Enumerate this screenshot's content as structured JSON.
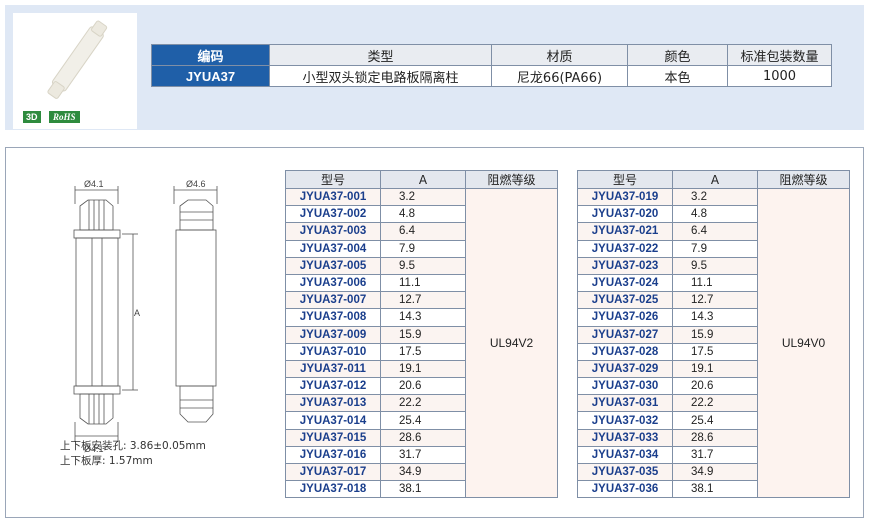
{
  "badges": {
    "three_d": "3D",
    "rohs": "RoHS"
  },
  "spec_table": {
    "headers": [
      "编码",
      "类型",
      "材质",
      "颜色",
      "标准包装数量"
    ],
    "row": [
      "JYUA37",
      "小型双头锁定电路板隔离柱",
      "尼龙66(PA66)",
      "本色",
      "1000"
    ]
  },
  "drawing": {
    "dim_top_left": "Ø4.1",
    "dim_top_right": "Ø4.6",
    "dim_bottom": "Ø4.1",
    "dim_length": "A"
  },
  "notes": {
    "hole": "上下板安装孔: 3.86±0.05mm",
    "thickness": "上下板厚: 1.57mm"
  },
  "parts_headers": [
    "型号",
    "A",
    "阻燃等级"
  ],
  "parts_left": {
    "grade": "UL94V2",
    "rows": [
      [
        "JYUA37-001",
        "3.2"
      ],
      [
        "JYUA37-002",
        "4.8"
      ],
      [
        "JYUA37-003",
        "6.4"
      ],
      [
        "JYUA37-004",
        "7.9"
      ],
      [
        "JYUA37-005",
        "9.5"
      ],
      [
        "JYUA37-006",
        "11.1"
      ],
      [
        "JYUA37-007",
        "12.7"
      ],
      [
        "JYUA37-008",
        "14.3"
      ],
      [
        "JYUA37-009",
        "15.9"
      ],
      [
        "JYUA37-010",
        "17.5"
      ],
      [
        "JYUA37-011",
        "19.1"
      ],
      [
        "JYUA37-012",
        "20.6"
      ],
      [
        "JYUA37-013",
        "22.2"
      ],
      [
        "JYUA37-014",
        "25.4"
      ],
      [
        "JYUA37-015",
        "28.6"
      ],
      [
        "JYUA37-016",
        "31.7"
      ],
      [
        "JYUA37-017",
        "34.9"
      ],
      [
        "JYUA37-018",
        "38.1"
      ]
    ]
  },
  "parts_right": {
    "grade": "UL94V0",
    "rows": [
      [
        "JYUA37-019",
        "3.2"
      ],
      [
        "JYUA37-020",
        "4.8"
      ],
      [
        "JYUA37-021",
        "6.4"
      ],
      [
        "JYUA37-022",
        "7.9"
      ],
      [
        "JYUA37-023",
        "9.5"
      ],
      [
        "JYUA37-024",
        "11.1"
      ],
      [
        "JYUA37-025",
        "12.7"
      ],
      [
        "JYUA37-026",
        "14.3"
      ],
      [
        "JYUA37-027",
        "15.9"
      ],
      [
        "JYUA37-028",
        "17.5"
      ],
      [
        "JYUA37-029",
        "19.1"
      ],
      [
        "JYUA37-030",
        "20.6"
      ],
      [
        "JYUA37-031",
        "22.2"
      ],
      [
        "JYUA37-032",
        "25.4"
      ],
      [
        "JYUA37-033",
        "28.6"
      ],
      [
        "JYUA37-034",
        "31.7"
      ],
      [
        "JYUA37-035",
        "34.9"
      ],
      [
        "JYUA37-036",
        "38.1"
      ]
    ]
  }
}
